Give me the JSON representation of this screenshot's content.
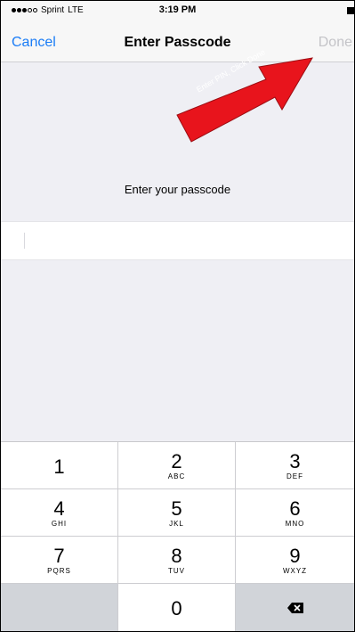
{
  "status_bar": {
    "carrier": "Sprint",
    "network": "LTE",
    "time": "3:19 PM",
    "signal_bars_filled": 3,
    "signal_bars_total": 5
  },
  "nav": {
    "cancel_label": "Cancel",
    "title": "Enter Passcode",
    "done_label": "Done"
  },
  "annotation": {
    "text": "Enter PIN, Click Done",
    "color": "#e8141c"
  },
  "prompt": {
    "text": "Enter your passcode"
  },
  "passcode_field": {
    "value": ""
  },
  "keypad": {
    "keys": [
      {
        "digit": "1",
        "letters": ""
      },
      {
        "digit": "2",
        "letters": "ABC"
      },
      {
        "digit": "3",
        "letters": "DEF"
      },
      {
        "digit": "4",
        "letters": "GHI"
      },
      {
        "digit": "5",
        "letters": "JKL"
      },
      {
        "digit": "6",
        "letters": "MNO"
      },
      {
        "digit": "7",
        "letters": "PQRS"
      },
      {
        "digit": "8",
        "letters": "TUV"
      },
      {
        "digit": "9",
        "letters": "WXYZ"
      },
      {
        "digit": "0",
        "letters": ""
      }
    ],
    "delete_icon": "backspace-icon"
  },
  "colors": {
    "accent": "#1a7cf6",
    "disabled": "#c4c4c8",
    "background": "#efeff4"
  }
}
